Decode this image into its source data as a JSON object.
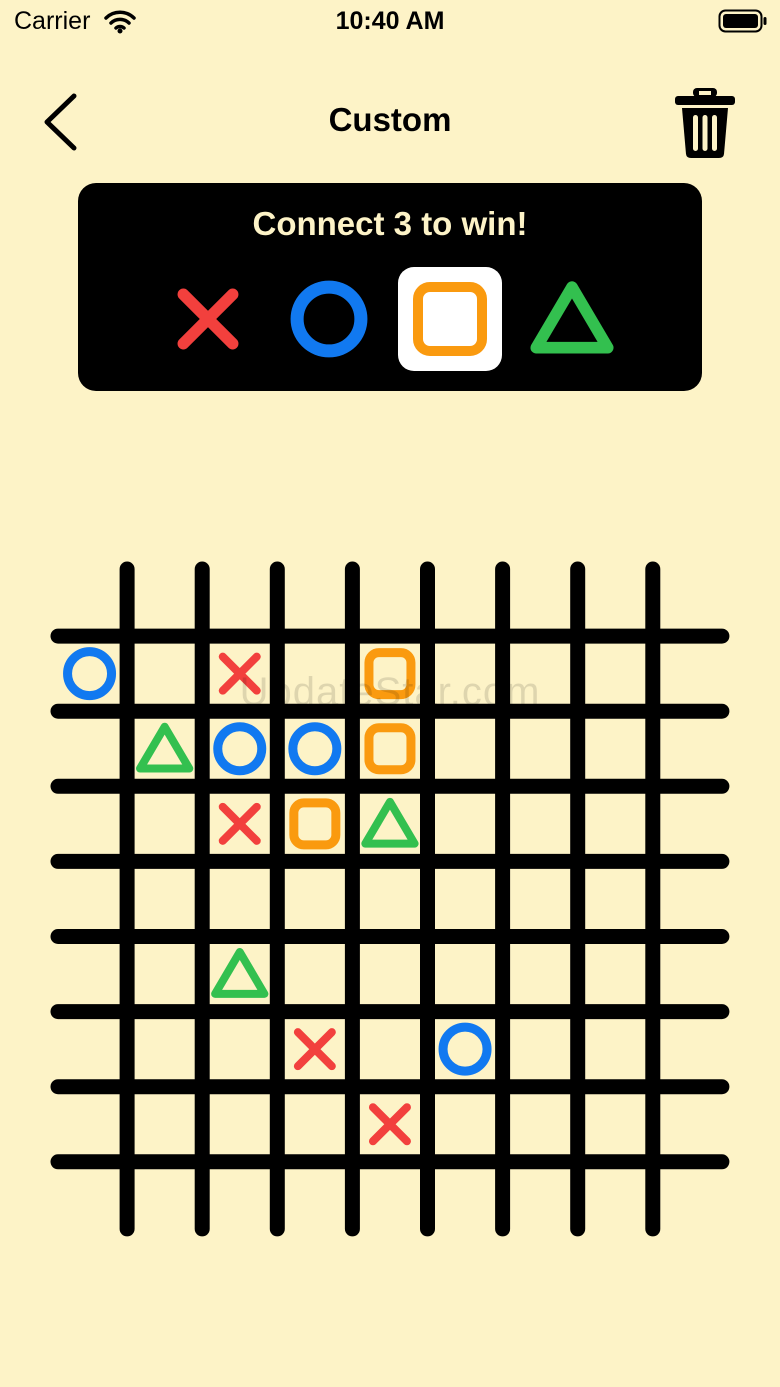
{
  "status_bar": {
    "carrier": "Carrier",
    "time": "10:40 AM"
  },
  "header": {
    "title": "Custom",
    "back_icon": "chevron-left-icon",
    "trash_icon": "trash-icon"
  },
  "panel": {
    "title": "Connect 3 to win!",
    "pieces": [
      {
        "type": "x",
        "color": "#F2403D",
        "selected": false
      },
      {
        "type": "o",
        "color": "#1179F0",
        "selected": false
      },
      {
        "type": "square",
        "color": "#FA9A0F",
        "selected": true
      },
      {
        "type": "triangle",
        "color": "#33C04F",
        "selected": false
      }
    ]
  },
  "board": {
    "columns": 9,
    "rows": 9,
    "cells": [
      {
        "col": 0,
        "row": 1,
        "piece": "o"
      },
      {
        "col": 2,
        "row": 1,
        "piece": "x"
      },
      {
        "col": 4,
        "row": 1,
        "piece": "square"
      },
      {
        "col": 1,
        "row": 2,
        "piece": "triangle"
      },
      {
        "col": 2,
        "row": 2,
        "piece": "o"
      },
      {
        "col": 3,
        "row": 2,
        "piece": "o"
      },
      {
        "col": 4,
        "row": 2,
        "piece": "square"
      },
      {
        "col": 2,
        "row": 3,
        "piece": "x"
      },
      {
        "col": 3,
        "row": 3,
        "piece": "square"
      },
      {
        "col": 4,
        "row": 3,
        "piece": "triangle"
      },
      {
        "col": 2,
        "row": 5,
        "piece": "triangle"
      },
      {
        "col": 3,
        "row": 6,
        "piece": "x"
      },
      {
        "col": 5,
        "row": 6,
        "piece": "o"
      },
      {
        "col": 4,
        "row": 7,
        "piece": "x"
      }
    ]
  },
  "colors": {
    "background": "#FDF3C7",
    "x": "#F2403D",
    "o": "#1179F0",
    "square": "#FA9A0F",
    "triangle": "#33C04F",
    "grid": "#000000"
  },
  "watermark": "UpdateStar.com"
}
